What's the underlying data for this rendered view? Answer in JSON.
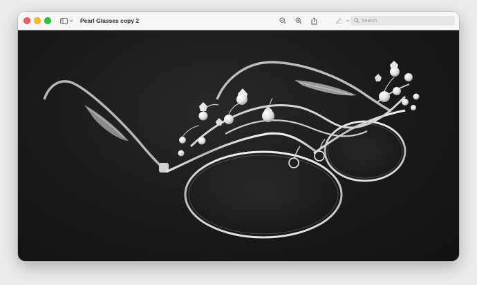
{
  "window": {
    "title": "Pearl Glasses copy 2",
    "controls": [
      "close",
      "minimize",
      "zoom"
    ]
  },
  "toolbar": {
    "tools": [
      {
        "name": "zoom-out-icon"
      },
      {
        "name": "zoom-in-icon"
      },
      {
        "name": "share-icon"
      },
      {
        "name": "markup-pen-icon"
      },
      {
        "name": "chevron-down-icon"
      },
      {
        "name": "rotate-icon"
      },
      {
        "name": "markup-circle-icon"
      }
    ]
  },
  "search": {
    "placeholder": "Search",
    "value": ""
  },
  "image": {
    "subject": "pearl-glasses",
    "background": "#1a1818"
  }
}
